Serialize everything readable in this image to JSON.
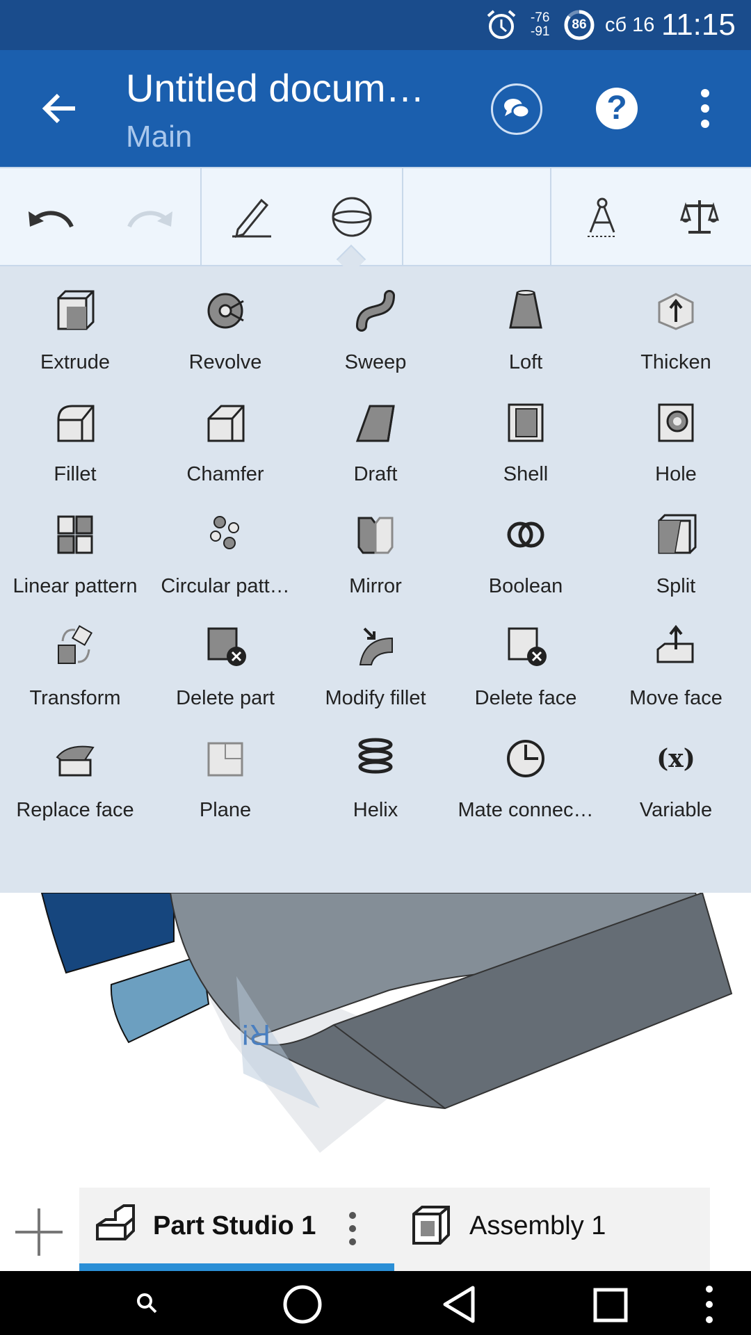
{
  "status_bar": {
    "signal_top": "-76",
    "signal_bottom": "-91",
    "battery": "86",
    "battery_level": 0.86,
    "date": "сб 16",
    "time": "11:15"
  },
  "app_bar": {
    "title": "Untitled docum…",
    "subtitle": "Main"
  },
  "colors": {
    "status_bar": "#1a4c8c",
    "app_bar": "#1b5fae",
    "panel": "#dbe4ee",
    "tab_indicator": "#2b8fd6"
  },
  "tools": [
    {
      "label": "Extrude",
      "icon": "extrude-icon"
    },
    {
      "label": "Revolve",
      "icon": "revolve-icon"
    },
    {
      "label": "Sweep",
      "icon": "sweep-icon"
    },
    {
      "label": "Loft",
      "icon": "loft-icon"
    },
    {
      "label": "Thicken",
      "icon": "thicken-icon"
    },
    {
      "label": "Fillet",
      "icon": "fillet-icon"
    },
    {
      "label": "Chamfer",
      "icon": "chamfer-icon"
    },
    {
      "label": "Draft",
      "icon": "draft-icon"
    },
    {
      "label": "Shell",
      "icon": "shell-icon"
    },
    {
      "label": "Hole",
      "icon": "hole-icon"
    },
    {
      "label": "Linear pattern",
      "icon": "linear-pattern-icon"
    },
    {
      "label": "Circular patt…",
      "icon": "circular-pattern-icon"
    },
    {
      "label": "Mirror",
      "icon": "mirror-icon"
    },
    {
      "label": "Boolean",
      "icon": "boolean-icon"
    },
    {
      "label": "Split",
      "icon": "split-icon"
    },
    {
      "label": "Transform",
      "icon": "transform-icon"
    },
    {
      "label": "Delete part",
      "icon": "delete-part-icon"
    },
    {
      "label": "Modify fillet",
      "icon": "modify-fillet-icon"
    },
    {
      "label": "Delete face",
      "icon": "delete-face-icon"
    },
    {
      "label": "Move face",
      "icon": "move-face-icon"
    },
    {
      "label": "Replace face",
      "icon": "replace-face-icon"
    },
    {
      "label": "Plane",
      "icon": "plane-icon"
    },
    {
      "label": "Helix",
      "icon": "helix-icon"
    },
    {
      "label": "Mate connec…",
      "icon": "mate-connector-icon"
    },
    {
      "label": "Variable",
      "icon": "variable-icon"
    }
  ],
  "variable_glyph": "(x)",
  "tabs": [
    {
      "label": "Part Studio 1",
      "active": true
    },
    {
      "label": "Assembly 1",
      "active": false
    }
  ]
}
